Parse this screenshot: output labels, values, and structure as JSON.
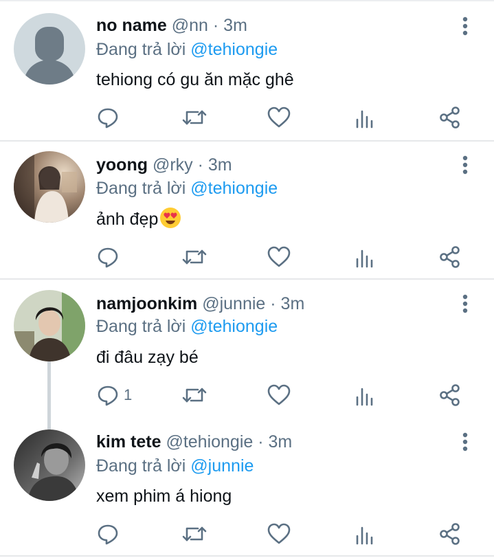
{
  "tweets": [
    {
      "name": "no name",
      "handle": "@nn",
      "separator": "·",
      "time": "3m",
      "reply_label": "Đang trả lời",
      "reply_to": "@tehiongie",
      "text": "tehiong có gu ăn mặc ghê",
      "avatar": "default-avatar",
      "reply_count": ""
    },
    {
      "name": "yoong",
      "handle": "@rky",
      "separator": "·",
      "time": "3m",
      "reply_label": "Đang trả lời",
      "reply_to": "@tehiongie",
      "text": "ảnh đẹp",
      "emoji": "heart-eyes-emoji",
      "avatar": "photo-avatar",
      "reply_count": ""
    },
    {
      "name": "namjoonkim",
      "handle": "@junnie",
      "separator": "·",
      "time": "3m",
      "reply_label": "Đang trả lời",
      "reply_to": "@tehiongie",
      "text": "đi đâu zạy bé",
      "avatar": "photo-avatar",
      "reply_count": "1"
    },
    {
      "name": "kim tete",
      "handle": "@tehiongie",
      "separator": "·",
      "time": "3m",
      "reply_label": "Đang trả lời",
      "reply_to": "@junnie",
      "text": "xem phim á hiong",
      "avatar": "photo-avatar",
      "reply_count": ""
    }
  ],
  "icons": {
    "reply": "reply-icon",
    "retweet": "retweet-icon",
    "like": "like-icon",
    "analytics": "analytics-icon",
    "share": "share-icon",
    "more": "more-icon"
  },
  "colors": {
    "mention": "#1d9bf0",
    "secondary_text": "#5b7083",
    "primary_text": "#0f1419",
    "divider": "#e6e8ea",
    "thread_line": "#cfd5da"
  }
}
